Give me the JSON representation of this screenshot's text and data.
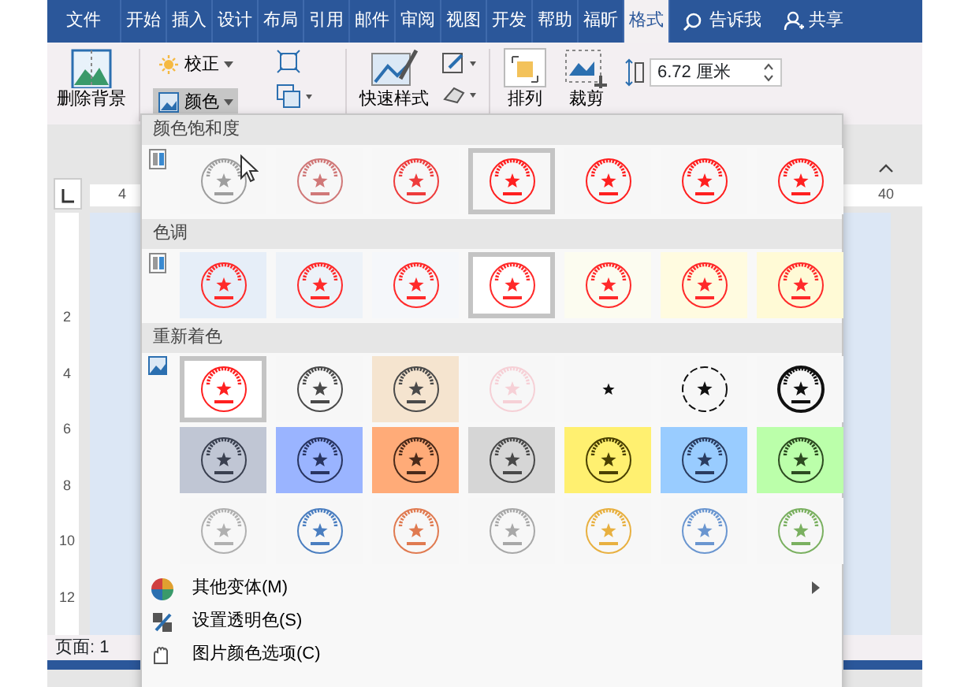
{
  "tabs": [
    {
      "label": "文件",
      "selected": false
    },
    {
      "label": "开始",
      "selected": false
    },
    {
      "label": "插入",
      "selected": false
    },
    {
      "label": "设计",
      "selected": false
    },
    {
      "label": "布局",
      "selected": false
    },
    {
      "label": "引用",
      "selected": false
    },
    {
      "label": "邮件",
      "selected": false
    },
    {
      "label": "审阅",
      "selected": false
    },
    {
      "label": "视图",
      "selected": false
    },
    {
      "label": "开发",
      "selected": false
    },
    {
      "label": "帮助",
      "selected": false
    },
    {
      "label": "福昕",
      "selected": false
    },
    {
      "label": "格式",
      "selected": true
    }
  ],
  "tell_me": {
    "label": "告诉我"
  },
  "share": {
    "label": "共享"
  },
  "ribbon": {
    "remove_background": "删除背景",
    "corrections": "校正",
    "color_button": {
      "label": "颜色",
      "pressed": true
    },
    "quick_styles": "快速样式",
    "arrange": "排列",
    "crop": "裁剪",
    "height_field": {
      "value": "6.72 厘米"
    }
  },
  "ruler": {
    "horizontal": [
      "4",
      "40"
    ],
    "vertical": [
      "2",
      "4",
      "6",
      "8",
      "10",
      "12"
    ]
  },
  "status_bar": {
    "page": "页面: 1"
  },
  "color_menu": {
    "sections": [
      {
        "title": "颜色饱和度",
        "kind": "swatch",
        "rows": [
          [
            {
              "color": "#f7f7f7",
              "selected": false,
              "stamp": {
                "kind": "stamp",
                "color": "#9e9e9e"
              }
            },
            {
              "color": "#f7f7f7",
              "selected": false,
              "stamp": {
                "kind": "stamp",
                "color": "#d07878"
              }
            },
            {
              "color": "#f7f7f7",
              "selected": false,
              "stamp": {
                "kind": "stamp",
                "color": "#ee3c3c"
              }
            },
            {
              "color": "#f7f7f7",
              "selected": true,
              "stamp": {
                "kind": "stamp",
                "color": "#ff2020"
              }
            },
            {
              "color": "#f7f7f7",
              "selected": false,
              "stamp": {
                "kind": "stamp",
                "color": "#ff2020"
              }
            },
            {
              "color": "#f7f7f7",
              "selected": false,
              "stamp": {
                "kind": "stamp",
                "color": "#ff2020"
              }
            },
            {
              "color": "#f7f7f7",
              "selected": false,
              "stamp": {
                "kind": "stamp",
                "color": "#ff2020"
              }
            }
          ]
        ]
      },
      {
        "title": "色调",
        "kind": "swatch",
        "rows": [
          [
            {
              "color": "#e6eef8",
              "selected": false,
              "stamp": {
                "kind": "stamp",
                "color": "#ff2a2a"
              }
            },
            {
              "color": "#edf2f8",
              "selected": false,
              "stamp": {
                "kind": "stamp",
                "color": "#ff2a2a"
              }
            },
            {
              "color": "#f5f7fa",
              "selected": false,
              "stamp": {
                "kind": "stamp",
                "color": "#ff2a2a"
              }
            },
            {
              "color": "#ffffff",
              "selected": true,
              "stamp": {
                "kind": "stamp",
                "color": "#ff2a2a"
              }
            },
            {
              "color": "#fcfcf0",
              "selected": false,
              "stamp": {
                "kind": "stamp",
                "color": "#ff2a2a"
              }
            },
            {
              "color": "#fffbe0",
              "selected": false,
              "stamp": {
                "kind": "stamp",
                "color": "#ff2a2a"
              }
            },
            {
              "color": "#fffad6",
              "selected": false,
              "stamp": {
                "kind": "stamp",
                "color": "#ff2a2a"
              }
            }
          ]
        ]
      },
      {
        "title": "重新着色",
        "kind": "image",
        "rows": [
          [
            {
              "color": "#ffffff",
              "selected": true,
              "stamp": {
                "kind": "stamp",
                "color": "#ff2020"
              }
            },
            {
              "color": "#f7f7f7",
              "selected": false,
              "stamp": {
                "kind": "stamp",
                "color": "#4a4a4a"
              }
            },
            {
              "color": "#f5e4cf",
              "selected": false,
              "stamp": {
                "kind": "stamp",
                "color": "#4a4a4a"
              }
            },
            {
              "color": "#f7f7f7",
              "selected": false,
              "stamp": {
                "kind": "stamp",
                "color": "#f6d0d6"
              }
            },
            {
              "color": "#f7f7f7",
              "selected": false,
              "stamp": {
                "kind": "star",
                "color": "#111111"
              }
            },
            {
              "color": "#f7f7f7",
              "selected": false,
              "stamp": {
                "kind": "dashed",
                "color": "#111111"
              }
            },
            {
              "color": "#f7f7f7",
              "selected": false,
              "stamp": {
                "kind": "heavy",
                "color": "#111111"
              }
            }
          ],
          [
            {
              "color": "#c0c6d4",
              "selected": false,
              "stamp": {
                "kind": "stamp",
                "color": "#3a4050"
              }
            },
            {
              "color": "#9ab4ff",
              "selected": false,
              "stamp": {
                "kind": "stamp",
                "color": "#283460"
              }
            },
            {
              "color": "#ffab78",
              "selected": false,
              "stamp": {
                "kind": "stamp",
                "color": "#4a2a1a"
              }
            },
            {
              "color": "#d6d6d6",
              "selected": false,
              "stamp": {
                "kind": "stamp",
                "color": "#484848"
              }
            },
            {
              "color": "#fff070",
              "selected": false,
              "stamp": {
                "kind": "stamp",
                "color": "#4a4000"
              }
            },
            {
              "color": "#99ccff",
              "selected": false,
              "stamp": {
                "kind": "stamp",
                "color": "#2a3c60"
              }
            },
            {
              "color": "#bbffaa",
              "selected": false,
              "stamp": {
                "kind": "stamp",
                "color": "#2c4a20"
              }
            }
          ],
          [
            {
              "color": "#f7f7f7",
              "selected": false,
              "stamp": {
                "kind": "stamp",
                "color": "#b0b0b0"
              }
            },
            {
              "color": "#f7f7f7",
              "selected": false,
              "stamp": {
                "kind": "stamp",
                "color": "#4a7ec0"
              }
            },
            {
              "color": "#f7f7f7",
              "selected": false,
              "stamp": {
                "kind": "stamp",
                "color": "#e07a50"
              }
            },
            {
              "color": "#f7f7f7",
              "selected": false,
              "stamp": {
                "kind": "stamp",
                "color": "#a8a8a8"
              }
            },
            {
              "color": "#f7f7f7",
              "selected": false,
              "stamp": {
                "kind": "stamp",
                "color": "#e8b040"
              }
            },
            {
              "color": "#f7f7f7",
              "selected": false,
              "stamp": {
                "kind": "stamp",
                "color": "#6a96d0"
              }
            },
            {
              "color": "#f7f7f7",
              "selected": false,
              "stamp": {
                "kind": "stamp",
                "color": "#7ab060"
              }
            }
          ]
        ]
      }
    ],
    "commands": [
      {
        "label": "其他变体(M)",
        "kind": "variants",
        "submenu": true
      },
      {
        "label": "设置透明色(S)",
        "kind": "transparent",
        "submenu": false
      },
      {
        "label": "图片颜色选项(C)",
        "kind": "options",
        "submenu": false
      }
    ]
  }
}
